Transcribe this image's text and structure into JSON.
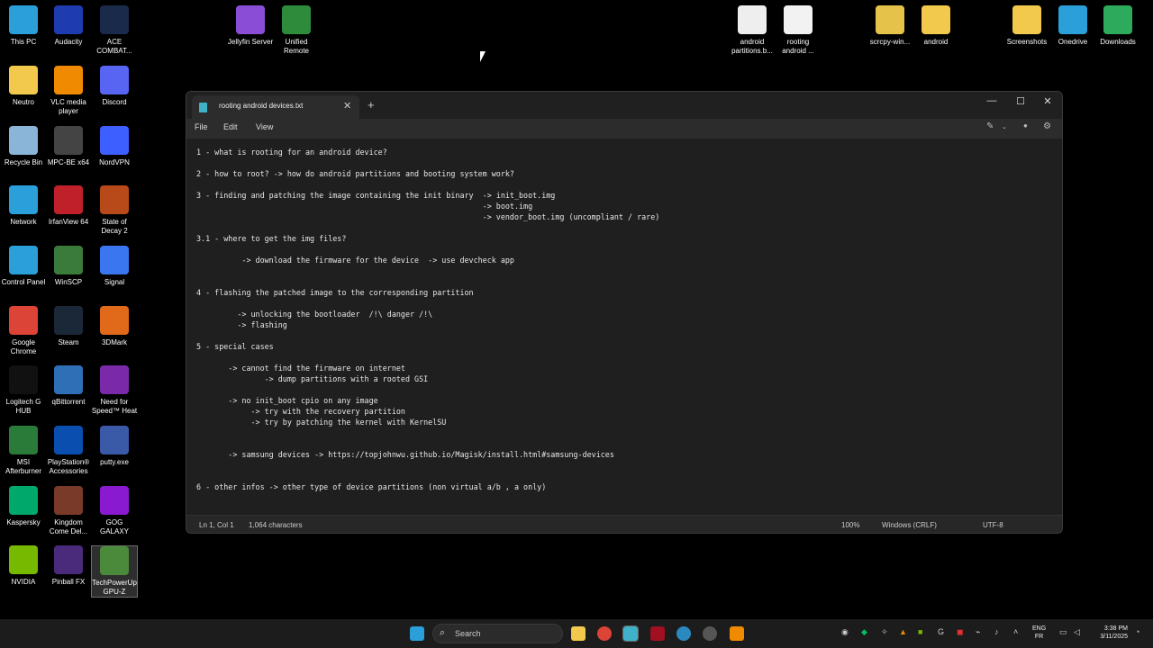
{
  "desktop_icons": [
    {
      "label": "This PC",
      "icon": "monitor-icon",
      "color": "#2b9fd9"
    },
    {
      "label": "Audacity",
      "icon": "audacity-icon",
      "color": "#1e3bb0"
    },
    {
      "label": "ACE COMBAT...",
      "icon": "ace-combat-icon",
      "color": "#1a2a4a"
    },
    {
      "label": "Jellyfin Server",
      "icon": "jellyfin-icon",
      "color": "#8a4dd6"
    },
    {
      "label": "Unified Remote",
      "icon": "unified-remote-icon",
      "color": "#2e8b3c"
    },
    {
      "label": "android partitions.b...",
      "icon": "file-icon",
      "color": "#eeeeee"
    },
    {
      "label": "rooting android ...",
      "icon": "text-file-icon",
      "color": "#f2f2f2"
    },
    {
      "label": "scrcpy-win...",
      "icon": "zip-folder-icon",
      "color": "#e5c24a"
    },
    {
      "label": "android",
      "icon": "folder-icon",
      "color": "#f2c94c"
    },
    {
      "label": "Screenshots",
      "icon": "folder-icon",
      "color": "#f2c94c"
    },
    {
      "label": "Onedrive",
      "icon": "cloud-icon",
      "color": "#2b9fd9"
    },
    {
      "label": "Downloads",
      "icon": "download-icon",
      "color": "#2eaa5c"
    },
    {
      "label": "Neutro",
      "icon": "folder-icon",
      "color": "#f2c94c"
    },
    {
      "label": "VLC media player",
      "icon": "vlc-icon",
      "color": "#f08a00"
    },
    {
      "label": "Discord",
      "icon": "discord-icon",
      "color": "#5865f2"
    },
    {
      "label": "Recycle Bin",
      "icon": "recycle-bin-icon",
      "color": "#8ab4d8"
    },
    {
      "label": "MPC-BE x64",
      "icon": "mpc-be-icon",
      "color": "#444444"
    },
    {
      "label": "NordVPN",
      "icon": "nordvpn-icon",
      "color": "#3e5fff"
    },
    {
      "label": "Network",
      "icon": "network-icon",
      "color": "#2b9fd9"
    },
    {
      "label": "IrfanView 64",
      "icon": "irfanview-icon",
      "color": "#c0202a"
    },
    {
      "label": "State of Decay 2",
      "icon": "state-of-decay-icon",
      "color": "#b84a1a"
    },
    {
      "label": "Control Panel",
      "icon": "control-panel-icon",
      "color": "#2b9fd9"
    },
    {
      "label": "WinSCP",
      "icon": "winscp-icon",
      "color": "#3a7a3a"
    },
    {
      "label": "Signal",
      "icon": "signal-icon",
      "color": "#3a76f0"
    },
    {
      "label": "Google Chrome",
      "icon": "chrome-icon",
      "color": "#db4437"
    },
    {
      "label": "Steam",
      "icon": "steam-icon",
      "color": "#1b2838"
    },
    {
      "label": "3DMark",
      "icon": "3dmark-icon",
      "color": "#e06a1a"
    },
    {
      "label": "Logitech G HUB",
      "icon": "logitech-icon",
      "color": "#111111"
    },
    {
      "label": "qBittorrent",
      "icon": "qbittorrent-icon",
      "color": "#2f6fb6"
    },
    {
      "label": "Need for Speed™ Heat",
      "icon": "nfs-heat-icon",
      "color": "#7a2aa8"
    },
    {
      "label": "MSI Afterburner",
      "icon": "msi-afterburner-icon",
      "color": "#2a7a3a"
    },
    {
      "label": "PlayStation® Accessories",
      "icon": "playstation-icon",
      "color": "#0a4fb0"
    },
    {
      "label": "putty.exe",
      "icon": "putty-icon",
      "color": "#3a5aa8"
    },
    {
      "label": "Kaspersky",
      "icon": "kaspersky-icon",
      "color": "#00a86b"
    },
    {
      "label": "Kingdom Come Del...",
      "icon": "kingdom-come-icon",
      "color": "#7a3a2a"
    },
    {
      "label": "GOG GALAXY",
      "icon": "gog-galaxy-icon",
      "color": "#8a1ad0"
    },
    {
      "label": "NVIDIA",
      "icon": "nvidia-icon",
      "color": "#76b900"
    },
    {
      "label": "Pinball FX",
      "icon": "pinball-fx-icon",
      "color": "#4a2a7a"
    },
    {
      "label": "TechPowerUp GPU-Z",
      "icon": "gpu-z-icon",
      "color": "#4a8a3a"
    }
  ],
  "window": {
    "tab_title": "rooting android devices.txt",
    "tab_close": "✕",
    "tab_add": "+",
    "minimize": "—",
    "maximize": "☐",
    "close": "✕"
  },
  "menu": {
    "file": "File",
    "edit": "Edit",
    "view": "View"
  },
  "editor_lines": [
    "1 - what is rooting for an android device?",
    "2 - how to root? -> how do android partitions and booting system work?",
    "3 - finding and patching the image containing the init binary  -> init_boot.img",
    "                                                               -> boot.img",
    "                                                               -> vendor_boot.img (uncompliant / rare)",
    "3.1 - where to get the img files?",
    "          -> download the firmware for the device  -> use devcheck app",
    "4 - flashing the patched image to the corresponding partition",
    "         -> unlocking the bootloader  /!\\ danger /!\\",
    "         -> flashing",
    "5 - special cases",
    "       -> cannot find the firmware on internet",
    "               -> dump partitions with a rooted GSI",
    "       -> no init_boot cpio on any image",
    "            -> try with the recovery partition",
    "            -> try by patching the kernel with KernelSU",
    "       -> samsung devices -> https://topjohnwu.github.io/Magisk/install.html#samsung-devices",
    "6 - other infos -> other type of device partitions (non virtual a/b , a only)"
  ],
  "status": {
    "position": "Ln 1, Col 1",
    "characters": "1,064 characters",
    "zoom": "100%",
    "line_ending": "Windows (CRLF)",
    "encoding": "UTF-8"
  },
  "taskbar": {
    "search_placeholder": "Search",
    "lang_top": "ENG",
    "lang_bottom": "FR",
    "time": "3:38 PM",
    "date": "3/11/2025"
  }
}
